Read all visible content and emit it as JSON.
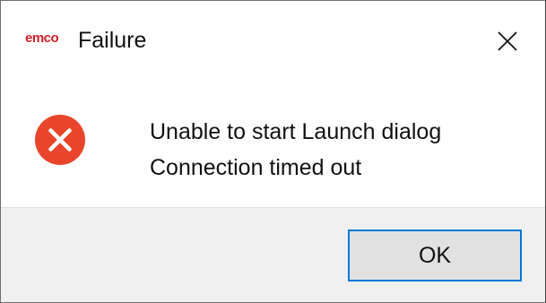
{
  "window": {
    "app_logo": "emco",
    "title": "Failure"
  },
  "icons": {
    "close": "close-icon",
    "status": "error-icon",
    "status_color": "#e8452c"
  },
  "message": {
    "line1": "Unable to start Launch dialog",
    "line2": "Connection timed out"
  },
  "buttons": {
    "ok_label": "OK"
  },
  "colors": {
    "logo": "#d0202a",
    "accent": "#0078d7",
    "footer_bg": "#f0f0f0",
    "error": "#e8452c"
  }
}
